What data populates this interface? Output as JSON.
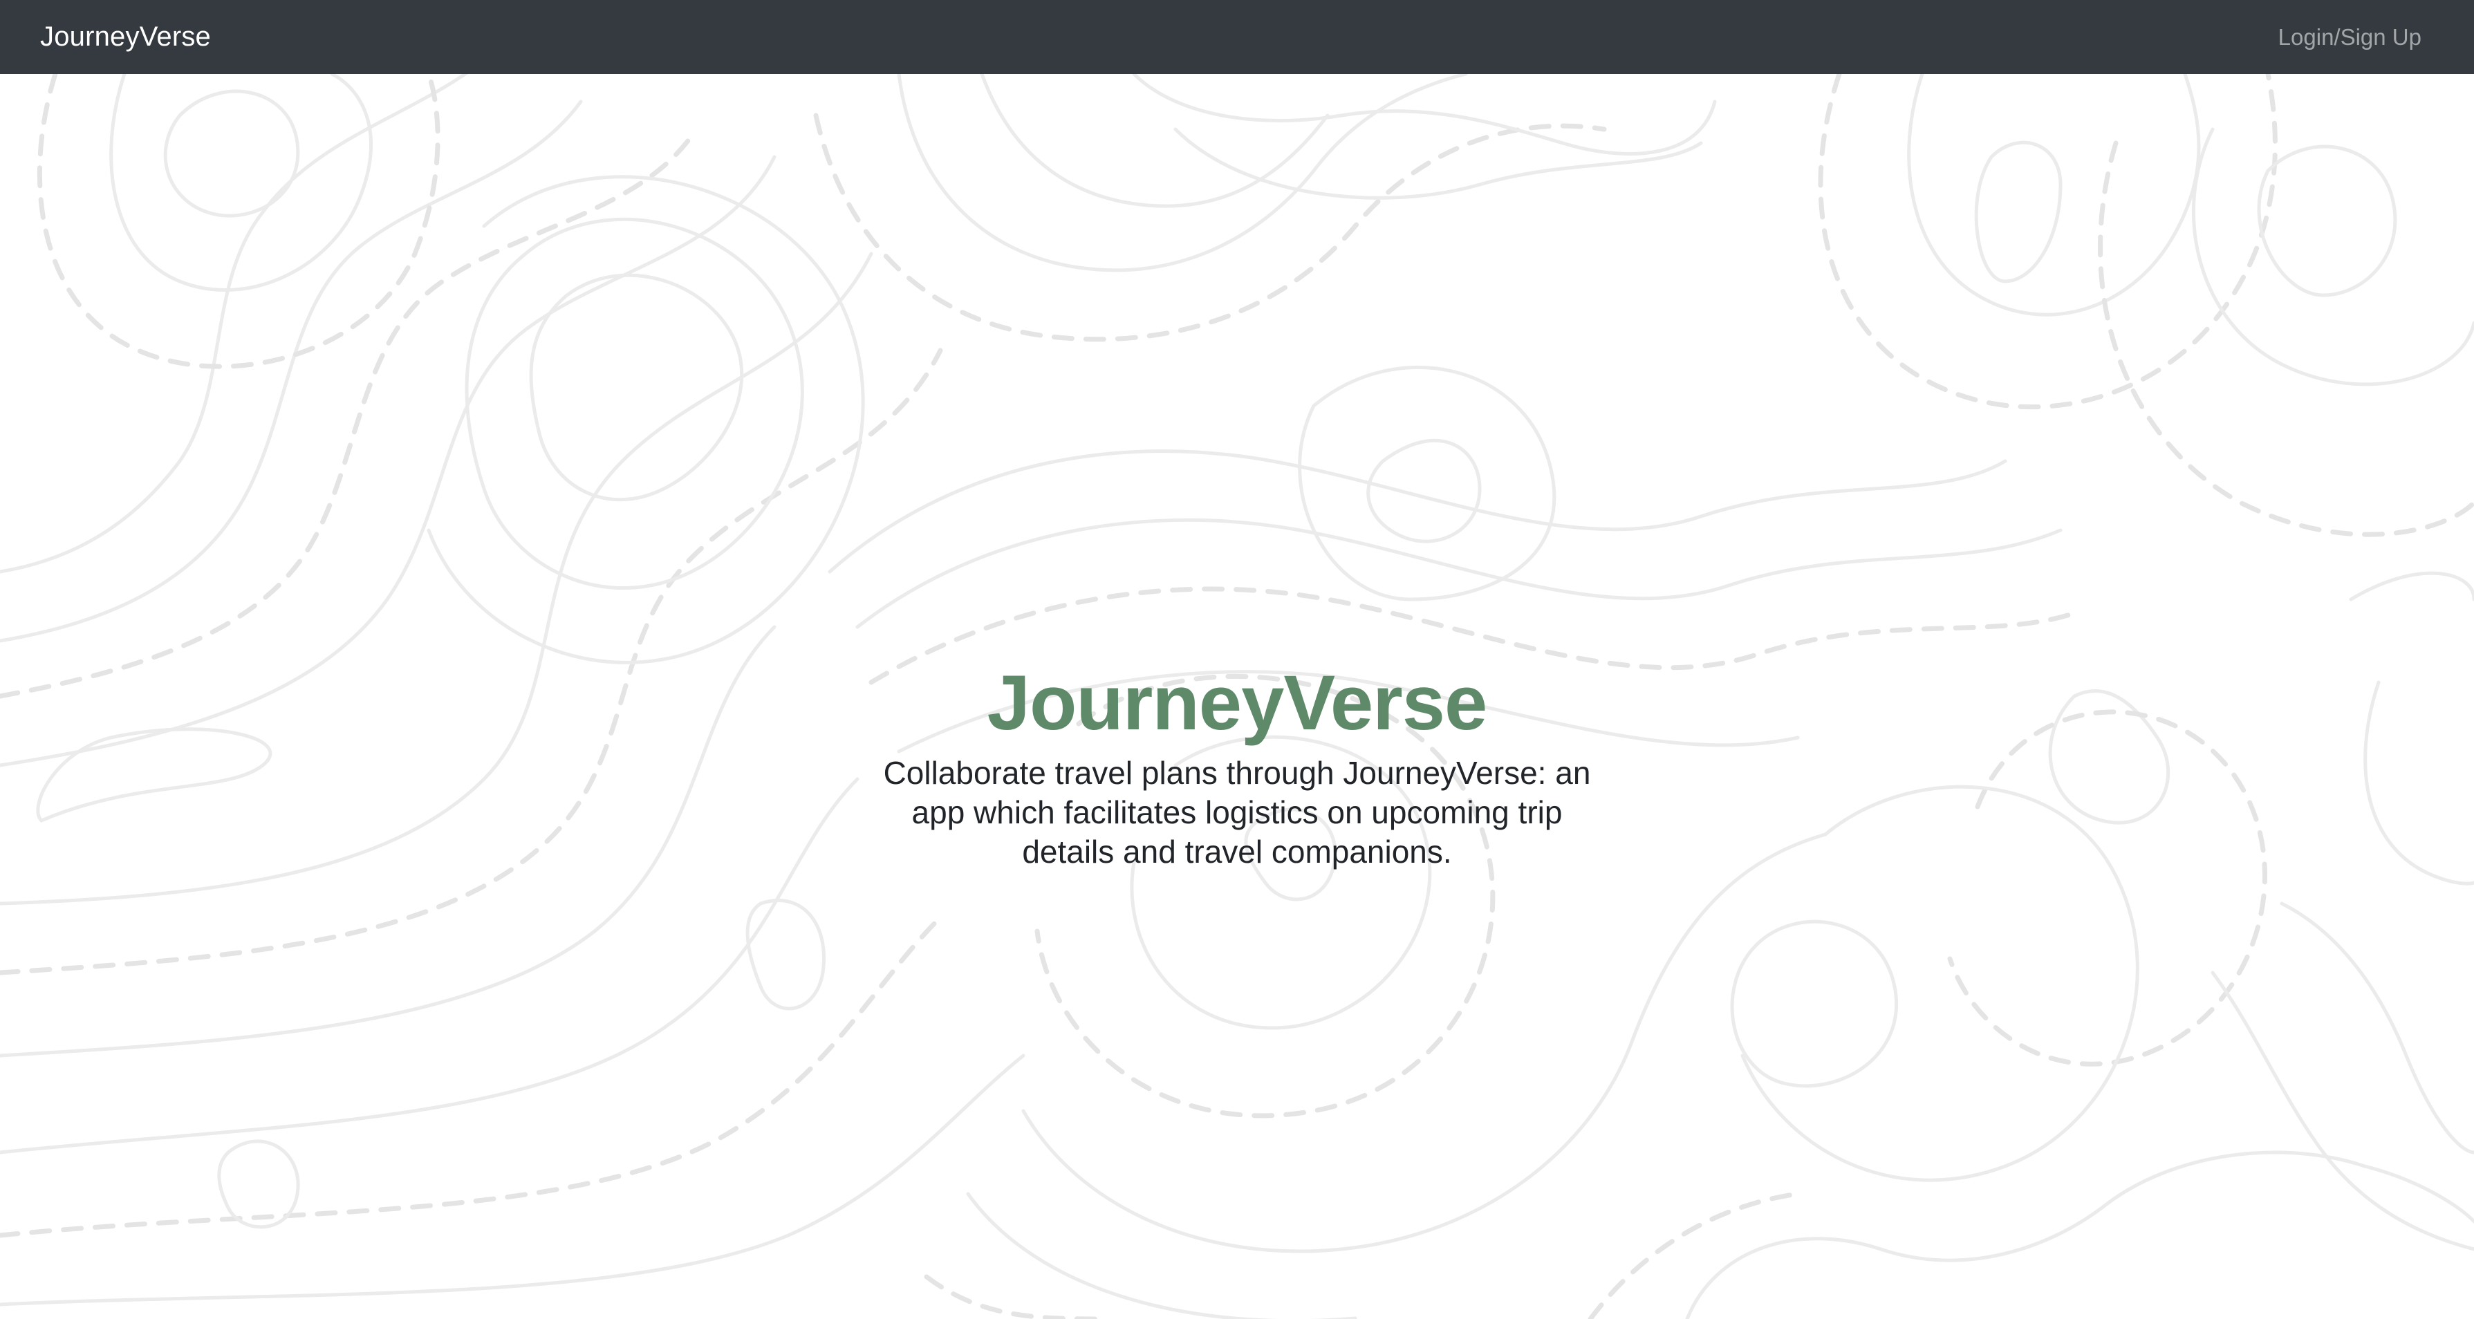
{
  "navbar": {
    "brand": "JourneyVerse",
    "login_label": "Login/Sign Up"
  },
  "hero": {
    "title": "JourneyVerse",
    "description": "Collaborate travel plans through JourneyVerse: an app which facilitates logistics on upcoming trip details and travel companions."
  },
  "colors": {
    "navbar_bg": "#343a40",
    "accent": "#5f8a6a",
    "background": "#ffffff",
    "contour_lines": "#ebebeb"
  },
  "background_pattern": "topographic-contour-lines"
}
